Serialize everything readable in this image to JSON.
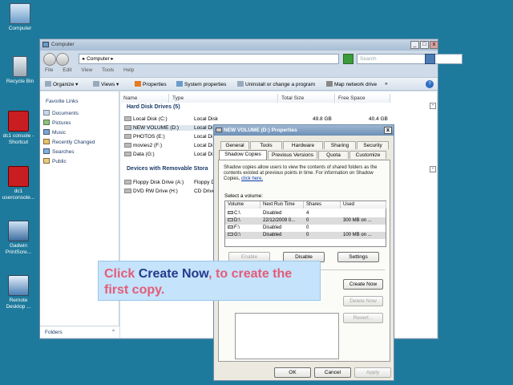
{
  "desktop": {
    "icons": [
      {
        "label": "Computer"
      },
      {
        "label": "Recycle Bin"
      },
      {
        "label": "dc1 console - Shortcut"
      },
      {
        "label": "dc1 userconsole..."
      },
      {
        "label": "Gadwin PrintScre..."
      },
      {
        "label": "Remote Desktop ..."
      }
    ]
  },
  "explorer": {
    "title": "Computer",
    "address": "▸ Computer ▸",
    "search_placeholder": "Search",
    "menu": [
      "File",
      "Edit",
      "View",
      "Tools",
      "Help"
    ],
    "commands": [
      "Organize",
      "Views",
      "Properties",
      "System properties",
      "Uninstall or change a program",
      "Map network drive",
      "»"
    ],
    "nav": {
      "title": "Favorite Links",
      "items": [
        "Documents",
        "Pictures",
        "Music",
        "Recently Changed",
        "Searches",
        "Public"
      ],
      "folders_label": "Folders"
    },
    "columns": [
      "Name",
      "Type",
      "Total Size",
      "Free Space"
    ],
    "groups": [
      {
        "title": "Hard Disk Drives (5)"
      },
      {
        "title": "Devices with Removable Stora"
      }
    ],
    "drives": [
      {
        "name": "Local Disk (C:)",
        "type": "Local Disk",
        "total": "49.8 GB",
        "free": "40.4 GB"
      },
      {
        "name": "NEW VOLUME (D:)",
        "type": "Local Di"
      },
      {
        "name": "PHOTOS (E:)",
        "type": "Local Di"
      },
      {
        "name": "movies2 (F:)",
        "type": "Local Di"
      },
      {
        "name": "Data (G:)",
        "type": "Local Di"
      }
    ],
    "removable": [
      {
        "name": "Floppy Disk Drive (A:)",
        "type": "Floppy D"
      },
      {
        "name": "DVD RW Drive (H:)",
        "type": "CD Drive"
      }
    ]
  },
  "dialog": {
    "title": "NEW VOLUME (D:) Properties",
    "tabs_row1": [
      "General",
      "Tools",
      "Hardware",
      "Sharing",
      "Security"
    ],
    "tabs_row2": [
      "Shadow Copies",
      "Previous Versions",
      "Quota",
      "Customize"
    ],
    "description": "Shadow copies allow users to view the contents of shared folders as the contents existed at previous points in time. For information on Shadow Copies,",
    "link": "click here.",
    "select_label": "Select a volume:",
    "list_headers": [
      "Volume",
      "Next Run Time",
      "Shares",
      "Used"
    ],
    "volumes": [
      {
        "volume": "C:\\",
        "next": "Disabled",
        "shares": "4",
        "used": ""
      },
      {
        "volume": "D:\\",
        "next": "22/12/2009 0...",
        "shares": "0",
        "used": "300 MB on ..."
      },
      {
        "volume": "F:\\",
        "next": "Disabled",
        "shares": "0",
        "used": ""
      },
      {
        "volume": "G:\\",
        "next": "Disabled",
        "shares": "0",
        "used": "100 MB on ..."
      }
    ],
    "buttons": {
      "enable": "Enable",
      "disable": "Disable",
      "settings": "Settings",
      "create_now": "Create Now",
      "delete_now": "Delete Now",
      "revert": "Revert...",
      "ok": "OK",
      "cancel": "Cancel",
      "apply": "Apply"
    }
  },
  "callout": {
    "part1": "Click ",
    "part2": "Create Now",
    "part3": ", to create the first copy."
  }
}
